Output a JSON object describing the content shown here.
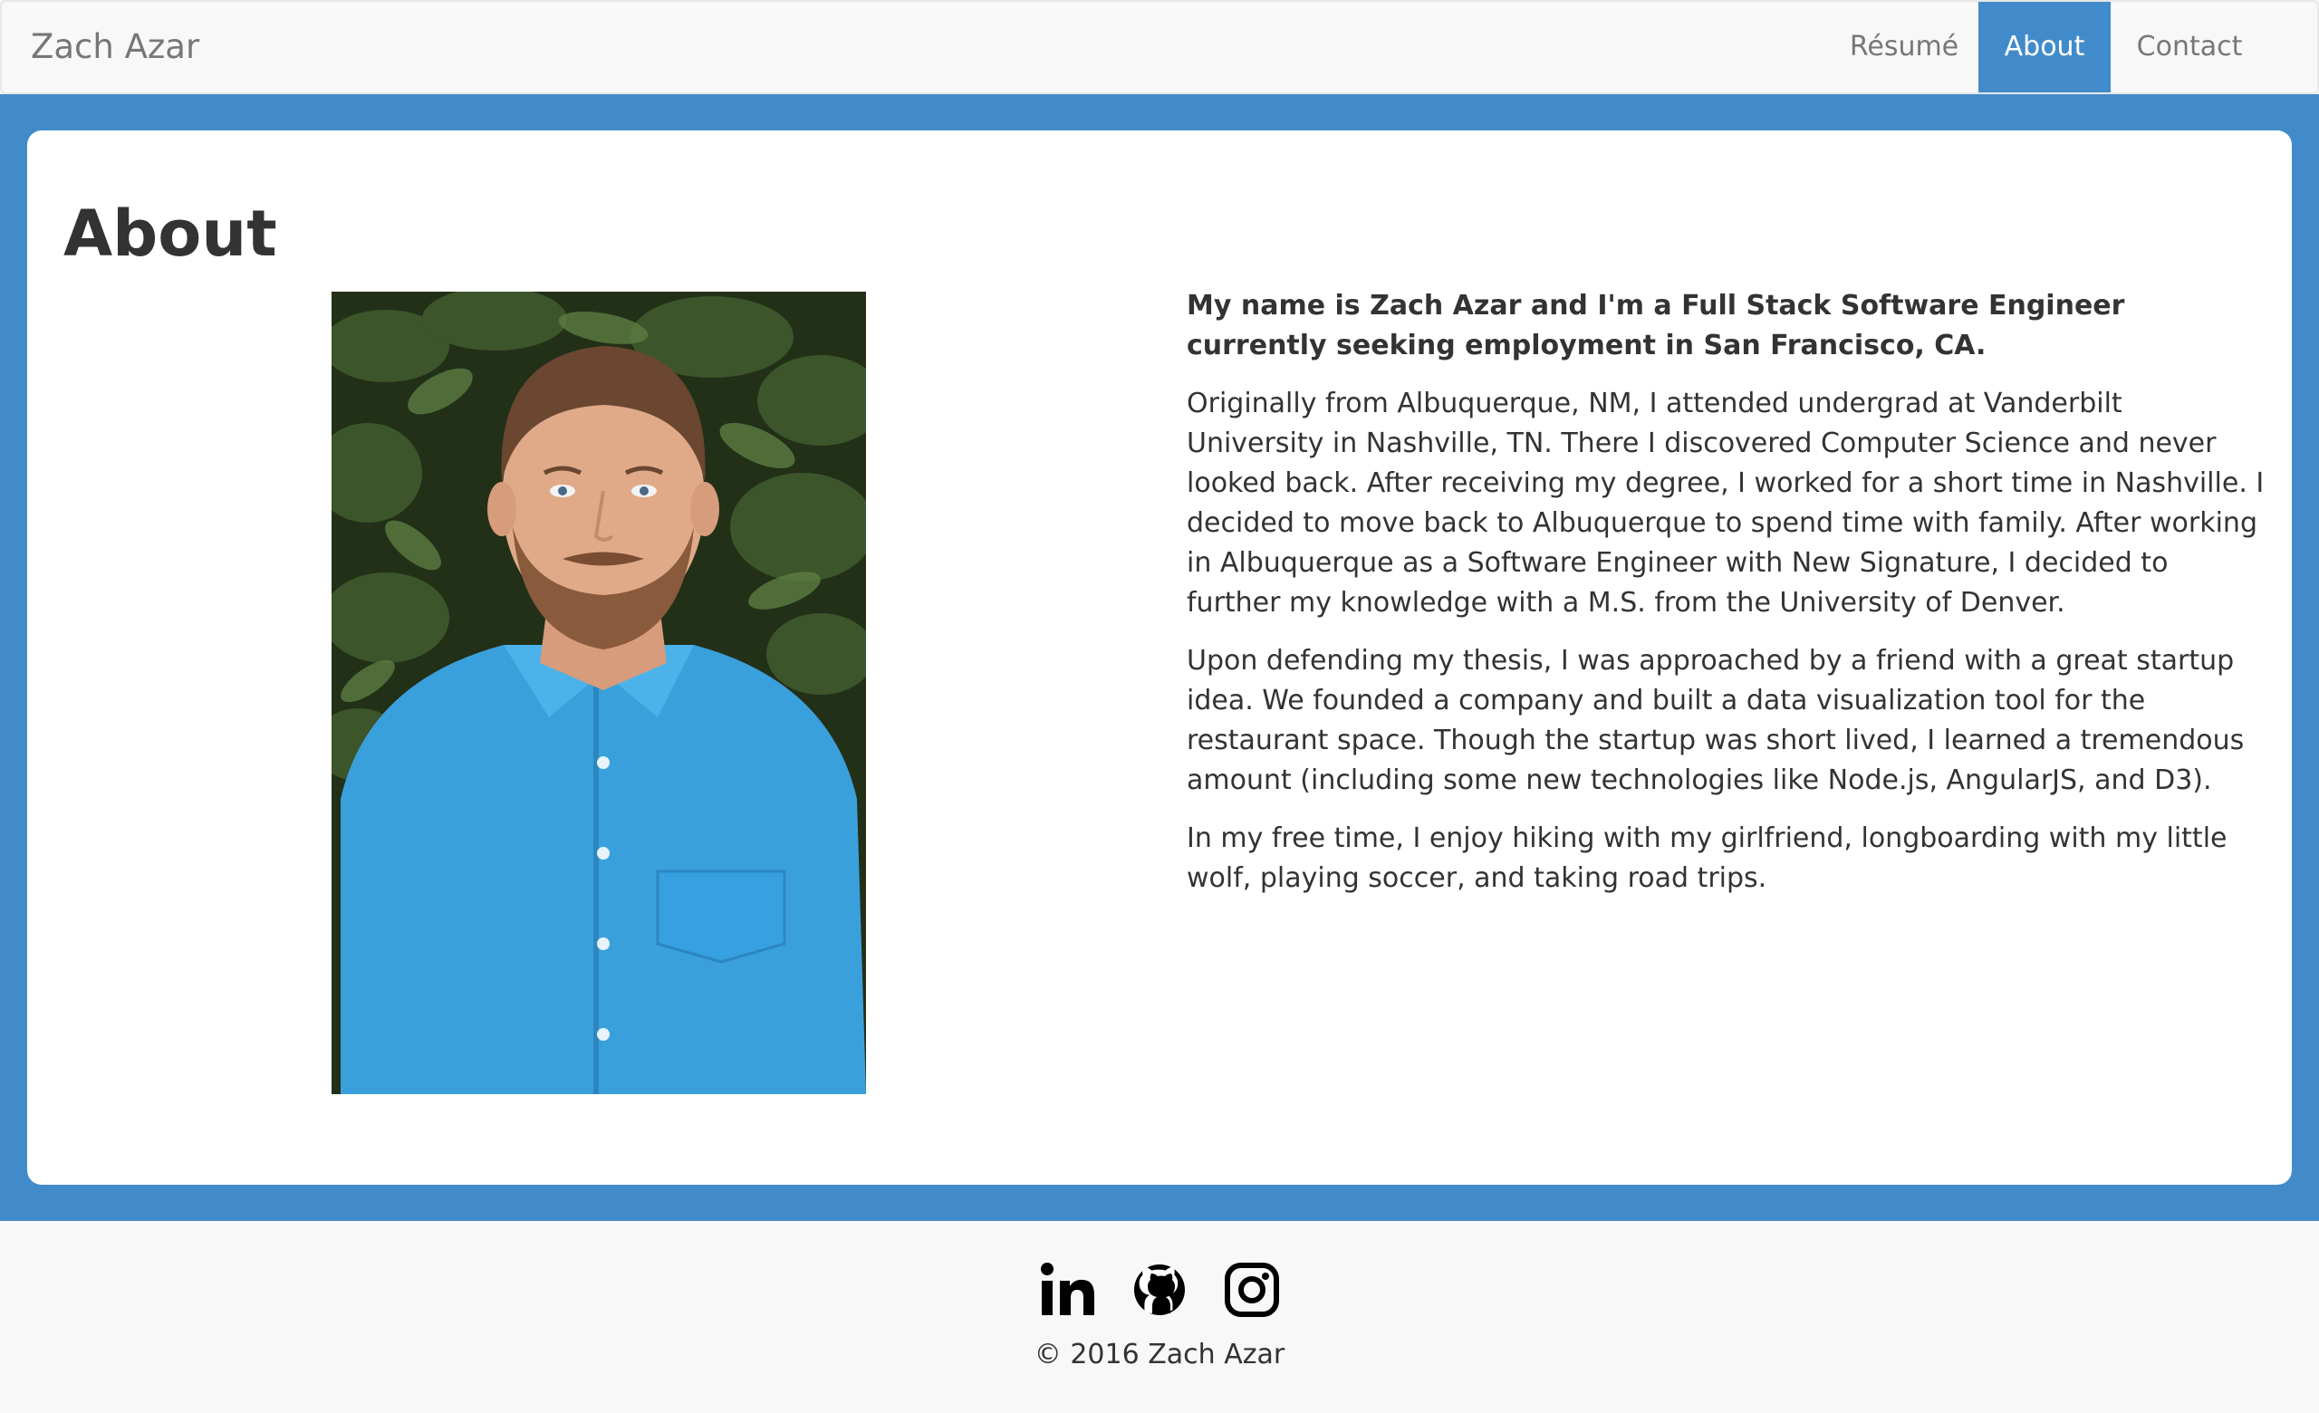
{
  "navbar": {
    "brand": "Zach Azar",
    "items": [
      {
        "label": "Résumé",
        "active": false
      },
      {
        "label": "About",
        "active": true
      },
      {
        "label": "Contact",
        "active": false
      }
    ]
  },
  "colors": {
    "accent": "#428bca",
    "navbar_bg": "#f8f8f8",
    "panel_bg": "#ffffff",
    "text": "#333333",
    "muted": "#777777"
  },
  "main": {
    "title": "About",
    "photo": {
      "subject": "portrait-photo"
    },
    "paragraphs": [
      "My name is Zach Azar and I'm a Full Stack Software Engineer currently seeking employment in San Francisco, CA.",
      "Originally from Albuquerque, NM, I attended undergrad at Vanderbilt University in Nashville, TN. There I discovered Computer Science and never looked back. After receiving my degree, I worked for a short time in Nashville. I decided to move back to Albuquerque to spend time with family. After working in Albuquerque as a Software Engineer with New Signature, I decided to further my knowledge with a M.S. from the University of Denver.",
      "Upon defending my thesis, I was approached by a friend with a great startup idea. We founded a company and built a data visualization tool for the restaurant space. Though the startup was short lived, I learned a tremendous amount (including some new technologies like Node.js, AngularJS, and D3).",
      "In my free time, I enjoy hiking with my girlfriend, longboarding with my little wolf, playing soccer, and taking road trips."
    ]
  },
  "footer": {
    "social": [
      {
        "icon": "linkedin-icon"
      },
      {
        "icon": "github-icon"
      },
      {
        "icon": "instagram-icon"
      }
    ],
    "copyright": "© 2016 Zach Azar"
  }
}
